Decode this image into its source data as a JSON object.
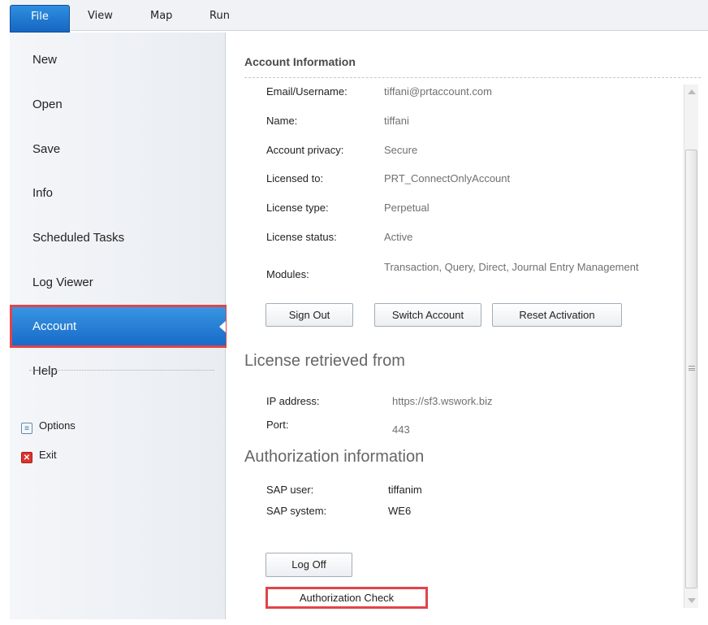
{
  "menu": {
    "tabs": [
      {
        "label": "File"
      },
      {
        "label": "View"
      },
      {
        "label": "Map"
      },
      {
        "label": "Run"
      }
    ]
  },
  "sidebar": {
    "items": [
      {
        "label": "New"
      },
      {
        "label": "Open"
      },
      {
        "label": "Save"
      },
      {
        "label": "Info"
      },
      {
        "label": "Scheduled Tasks"
      },
      {
        "label": "Log Viewer"
      },
      {
        "label": "Account"
      },
      {
        "label": "Help"
      }
    ],
    "active": "Account",
    "small_items": [
      {
        "label": "Options",
        "icon": "options-icon"
      },
      {
        "label": "Exit",
        "icon": "exit-icon"
      }
    ]
  },
  "account": {
    "title": "Account Information",
    "rows": [
      {
        "label": "Email/Username:",
        "value": "tiffani@prtaccount.com"
      },
      {
        "label": "Name:",
        "value": "tiffani"
      },
      {
        "label": "Account privacy:",
        "value": "Secure"
      },
      {
        "label": "Licensed to:",
        "value": "PRT_ConnectOnlyAccount"
      },
      {
        "label": "License type:",
        "value": "Perpetual"
      },
      {
        "label": "License status:",
        "value": "Active"
      },
      {
        "label": "Modules:",
        "value": "Transaction, Query, Direct, Journal Entry Management"
      }
    ],
    "buttons": {
      "sign_out": "Sign Out",
      "switch_account": "Switch Account",
      "reset_activation": "Reset Activation"
    }
  },
  "license": {
    "heading": "License retrieved from",
    "rows": [
      {
        "label": "IP address:",
        "value": "https://sf3.wswork.biz"
      },
      {
        "label": "Port:",
        "value": "443"
      }
    ]
  },
  "authorization": {
    "heading": "Authorization information",
    "rows": [
      {
        "label": "SAP user:",
        "value": "tiffanim"
      },
      {
        "label": "SAP system:",
        "value": "WE6"
      }
    ],
    "log_off": "Log Off",
    "check": "Authorization Check"
  },
  "colors": {
    "accent": "#1e7bd6",
    "highlight": "#e0444a"
  }
}
